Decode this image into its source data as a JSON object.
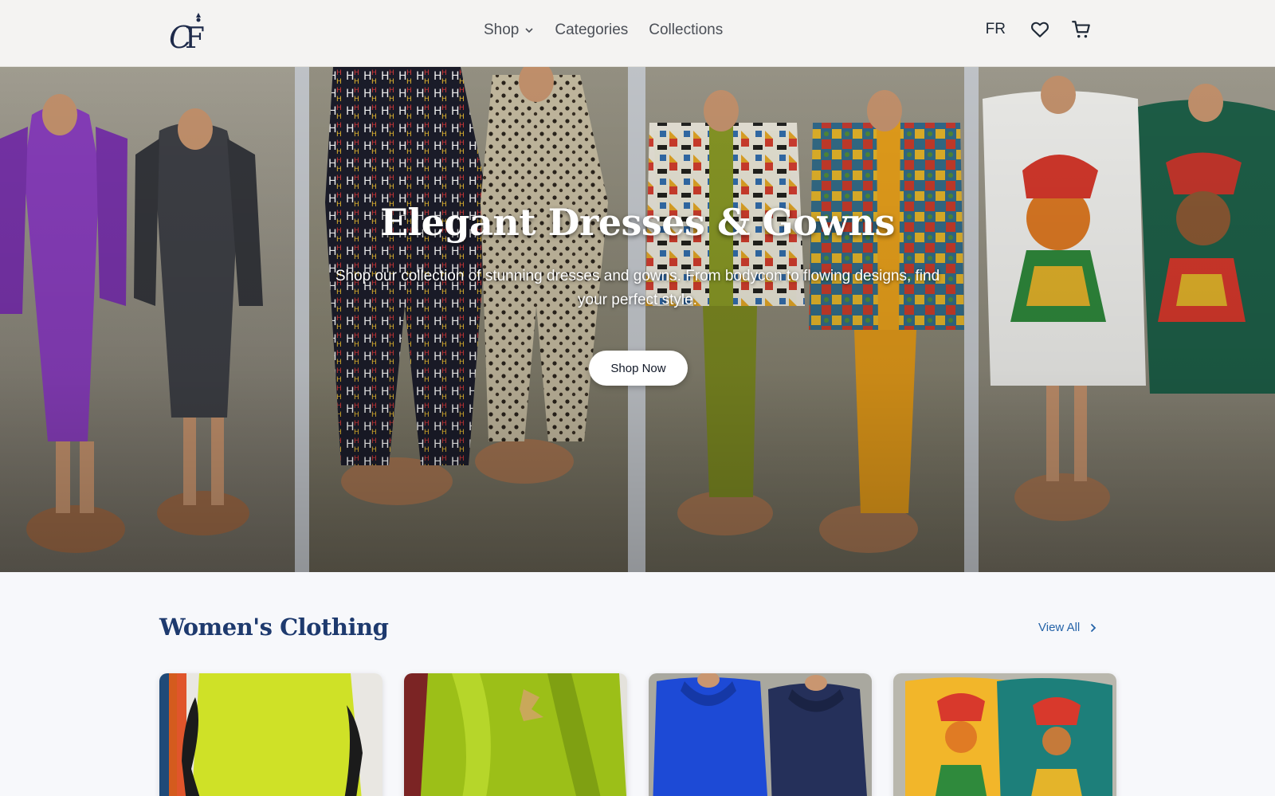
{
  "header": {
    "logo_text": "CF",
    "nav": [
      {
        "label": "Shop",
        "has_dropdown": true
      },
      {
        "label": "Categories"
      },
      {
        "label": "Collections"
      }
    ],
    "language": "FR",
    "icons": [
      "heart-icon",
      "cart-icon"
    ]
  },
  "hero": {
    "title": "Elegant Dresses & Gowns",
    "subtitle": "Shop our collection of stunning dresses and gowns. From bodycon to flowing designs, find your perfect style.",
    "cta_label": "Shop Now"
  },
  "section": {
    "title": "Women's Clothing",
    "view_all_label": "View All"
  },
  "colors": {
    "accent": "#1e3a6e",
    "link": "#2563a8",
    "background": "#f7f8fb"
  }
}
